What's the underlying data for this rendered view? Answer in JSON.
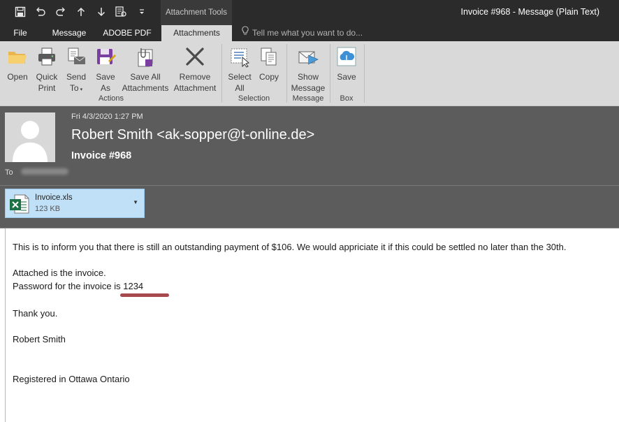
{
  "titlebar": {
    "contextual_group": "Attachment Tools",
    "window_title": "Invoice #968 - Message (Plain Text)",
    "qat_icons": [
      "save-icon",
      "undo-icon",
      "redo-icon",
      "up-arrow-icon",
      "down-arrow-icon",
      "print-preview-icon",
      "customize-icon"
    ]
  },
  "tabs": [
    {
      "label": "File"
    },
    {
      "label": "Message"
    },
    {
      "label": "ADOBE PDF"
    },
    {
      "label": "Attachments"
    }
  ],
  "tell_me": "Tell me what you want to do...",
  "ribbon": {
    "actions": {
      "label": "Actions",
      "buttons": [
        {
          "line1": "Open",
          "line2": "",
          "icon": "open-folder-icon"
        },
        {
          "line1": "Quick",
          "line2": "Print",
          "icon": "printer-icon"
        },
        {
          "line1": "Send",
          "line2": "To",
          "icon": "send-to-icon"
        },
        {
          "line1": "Save",
          "line2": "As",
          "icon": "save-as-icon"
        },
        {
          "line1": "Save All",
          "line2": "Attachments",
          "icon": "save-all-attachments-icon"
        },
        {
          "line1": "Remove",
          "line2": "Attachment",
          "icon": "remove-attachment-icon"
        }
      ]
    },
    "selection": {
      "label": "Selection",
      "buttons": [
        {
          "line1": "Select",
          "line2": "All",
          "icon": "select-all-icon"
        },
        {
          "line1": "Copy",
          "line2": "",
          "icon": "copy-icon"
        }
      ]
    },
    "message": {
      "label": "Message",
      "buttons": [
        {
          "line1": "Show",
          "line2": "Message",
          "icon": "show-message-icon"
        }
      ]
    },
    "box": {
      "label": "Box",
      "buttons": [
        {
          "line1": "Save",
          "line2": "",
          "icon": "box-save-icon"
        }
      ]
    }
  },
  "header": {
    "date": "Fri 4/3/2020 1:27 PM",
    "from": "Robert Smith <ak-sopper@t-online.de>",
    "subject": "Invoice #968",
    "to_label": "To"
  },
  "attachment": {
    "name": "Invoice.xls",
    "size": "123 KB",
    "icon": "excel-file-icon"
  },
  "body": {
    "lines": [
      "This is to inform you that there is still an outstanding payment of $106. We would appriciate it if this could be settled no later than the 30th.",
      "Attached is the invoice.",
      "Password for the invoice is 1234",
      "Thank you.",
      "Robert Smith",
      "Registered in Ottawa Ontario"
    ]
  },
  "colors": {
    "titlebar": "#2b2b2b",
    "ribbon": "#d9d9d9",
    "header": "#5c5c5c",
    "attachment_bg": "#bfe0f7",
    "annotation_underline": "#a64a4f"
  }
}
